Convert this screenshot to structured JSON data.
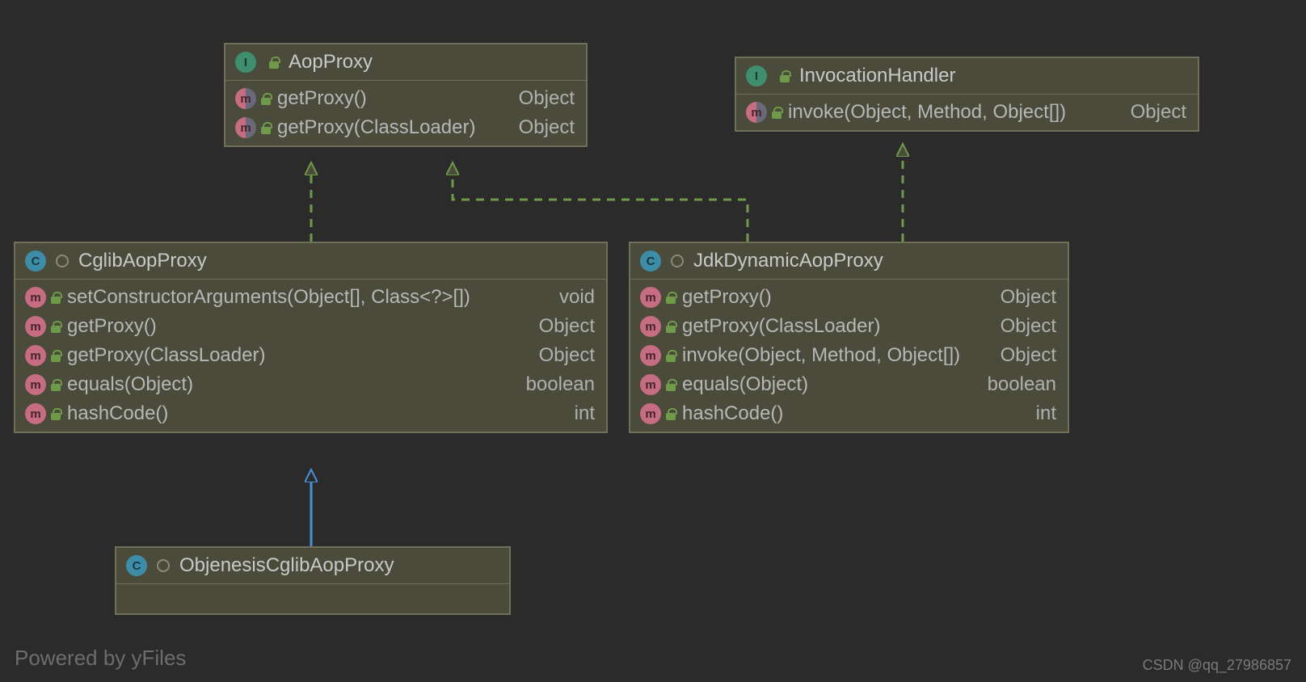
{
  "watermark_left": "Powered by yFiles",
  "watermark_right": "CSDN @qq_27986857",
  "colors": {
    "arrow_implements": "#6f9a4a",
    "arrow_extends": "#4a90d9"
  },
  "boxes": {
    "aopProxy": {
      "title": "AopProxy",
      "kind": "interface",
      "members": [
        {
          "sig": "getProxy()",
          "ret": "Object",
          "icon": "method-half"
        },
        {
          "sig": "getProxy(ClassLoader)",
          "ret": "Object",
          "icon": "method-half"
        }
      ]
    },
    "invocationHandler": {
      "title": "InvocationHandler",
      "kind": "interface",
      "members": [
        {
          "sig": "invoke(Object, Method, Object[])",
          "ret": "Object",
          "icon": "method-half"
        }
      ]
    },
    "cglib": {
      "title": "CglibAopProxy",
      "kind": "class",
      "members": [
        {
          "sig": "setConstructorArguments(Object[], Class<?>[])",
          "ret": "void",
          "icon": "method"
        },
        {
          "sig": "getProxy()",
          "ret": "Object",
          "icon": "method"
        },
        {
          "sig": "getProxy(ClassLoader)",
          "ret": "Object",
          "icon": "method"
        },
        {
          "sig": "equals(Object)",
          "ret": "boolean",
          "icon": "method"
        },
        {
          "sig": "hashCode()",
          "ret": "int",
          "icon": "method"
        }
      ]
    },
    "jdk": {
      "title": "JdkDynamicAopProxy",
      "kind": "class",
      "members": [
        {
          "sig": "getProxy()",
          "ret": "Object",
          "icon": "method"
        },
        {
          "sig": "getProxy(ClassLoader)",
          "ret": "Object",
          "icon": "method"
        },
        {
          "sig": "invoke(Object, Method, Object[])",
          "ret": "Object",
          "icon": "method"
        },
        {
          "sig": "equals(Object)",
          "ret": "boolean",
          "icon": "method"
        },
        {
          "sig": "hashCode()",
          "ret": "int",
          "icon": "method"
        }
      ]
    },
    "objenesis": {
      "title": "ObjenesisCglibAopProxy",
      "kind": "class",
      "members": []
    }
  }
}
